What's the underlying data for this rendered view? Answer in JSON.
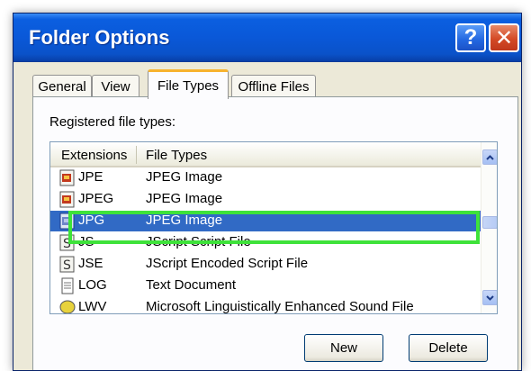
{
  "window": {
    "title": "Folder Options",
    "help_label": "?",
    "close_label": "✕"
  },
  "tabs": [
    {
      "label": "General"
    },
    {
      "label": "View"
    },
    {
      "label": "File Types",
      "active": true
    },
    {
      "label": "Offline Files"
    }
  ],
  "panel": {
    "label": "Registered file types:",
    "columns": {
      "ext": "Extensions",
      "type": "File Types"
    },
    "rows": [
      {
        "ext": "JPE",
        "type": "JPEG Image",
        "icon": "jpeg-image-icon"
      },
      {
        "ext": "JPEG",
        "type": "JPEG Image",
        "icon": "jpeg-image-icon"
      },
      {
        "ext": "JPG",
        "type": "JPEG Image",
        "icon": "jpeg-image-icon",
        "selected": true
      },
      {
        "ext": "JS",
        "type": "JScript Script File",
        "icon": "script-file-icon"
      },
      {
        "ext": "JSE",
        "type": "JScript Encoded Script File",
        "icon": "script-file-icon"
      },
      {
        "ext": "LOG",
        "type": "Text Document",
        "icon": "text-document-icon"
      },
      {
        "ext": "LWV",
        "type": "Microsoft Linguistically Enhanced Sound File",
        "icon": "sound-file-icon"
      }
    ]
  },
  "buttons": {
    "new": "New",
    "delete": "Delete"
  },
  "colors": {
    "selection": "#316ac5",
    "highlight": "#3ee23a",
    "title_bar": "#0a58d8"
  }
}
